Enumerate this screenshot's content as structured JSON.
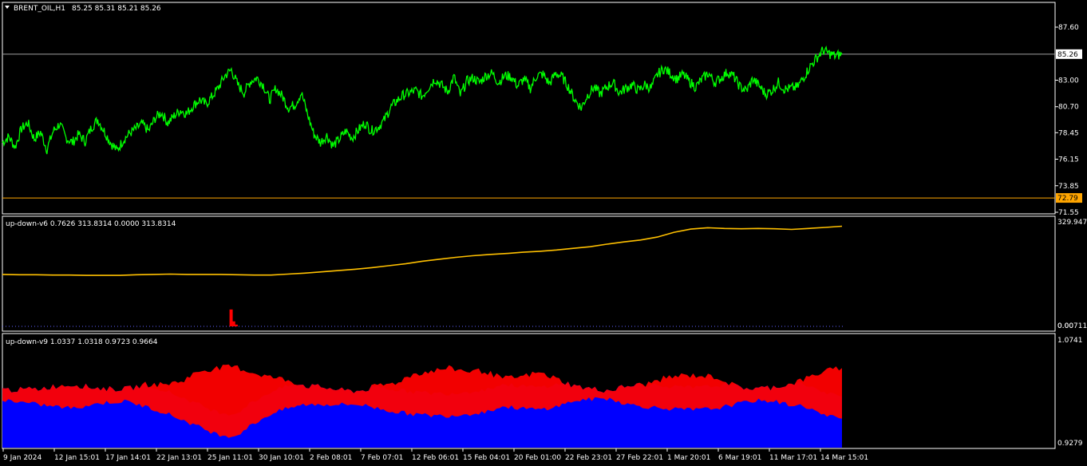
{
  "header": {
    "symbol": "BRENT_OIL,H1",
    "ohlc": "85.25 85.31 85.21 85.26"
  },
  "panels": {
    "price": {
      "y_ticks": [
        "87.60",
        "83.00",
        "80.70",
        "78.45",
        "76.15",
        "73.85",
        "71.55"
      ],
      "current_price_label": "85.26",
      "level_label": "72.79"
    },
    "ind1": {
      "title": "up-down-v6 0.7626 313.8314 0.0000 313.8314",
      "top_tick": "329.9472",
      "bottom_tick": "0.007118",
      "bottom_tick_overlay": "0.00"
    },
    "ind2": {
      "title": "up-down-v9 1.0337 1.0318 0.9723 0.9664",
      "top_tick": "1.0741",
      "bottom_tick": "0.9279"
    }
  },
  "x_axis": {
    "labels": [
      "9 Jan 2024",
      "12 Jan 15:01",
      "17 Jan 14:01",
      "22 Jan 13:01",
      "25 Jan 11:01",
      "30 Jan 10:01",
      "2 Feb 08:01",
      "7 Feb 07:01",
      "12 Feb 06:01",
      "15 Feb 04:01",
      "20 Feb 01:00",
      "22 Feb 23:01",
      "27 Feb 22:01",
      "1 Mar 20:01",
      "6 Mar 19:01",
      "11 Mar 17:01",
      "14 Mar 15:01"
    ]
  },
  "colors": {
    "background": "#000000",
    "price_line": "#00ff00",
    "level_line": "#ffa500",
    "current_line": "#a0a0a0",
    "ind1_line": "#ffc000",
    "ind1_bars": "#ff0000",
    "ind1_low": "#6060ff",
    "ind2_up": "#ff0000",
    "ind2_down": "#0000ff",
    "frame": "#ffffff"
  },
  "chart_data": [
    {
      "type": "line",
      "title": "BRENT_OIL,H1",
      "ylim": [
        71.55,
        87.6
      ],
      "series": [
        {
          "values": [
            77.6,
            78.1,
            77.2,
            78.8,
            79.3,
            77.9,
            78.5,
            77.0,
            78.6,
            79.2,
            78.0,
            77.6,
            78.3,
            77.7,
            78.9,
            79.6,
            78.6,
            77.6,
            76.9,
            77.8,
            78.4,
            78.8,
            79.2,
            78.6,
            79.7,
            80.2,
            79.3,
            79.9,
            80.4,
            80.1,
            80.8,
            81.3,
            80.9,
            81.6,
            82.4,
            83.4,
            83.9,
            82.6,
            81.9,
            82.9,
            83.2,
            82.6,
            81.3,
            82.3,
            81.6,
            80.6,
            80.9,
            81.9,
            80.0,
            78.3,
            77.6,
            78.2,
            77.3,
            77.9,
            78.6,
            78.0,
            78.7,
            79.3,
            78.6,
            78.9,
            79.5,
            80.6,
            81.2,
            81.7,
            81.9,
            82.1,
            81.6,
            82.4,
            83.1,
            82.6,
            82.0,
            83.3,
            81.7,
            82.9,
            83.2,
            82.8,
            83.4,
            83.6,
            82.8,
            83.4,
            83.3,
            82.5,
            83.1,
            82.3,
            83.4,
            83.5,
            82.7,
            83.6,
            83.3,
            82.4,
            81.3,
            80.6,
            81.7,
            82.4,
            81.8,
            82.4,
            82.8,
            81.9,
            82.3,
            82.6,
            82.1,
            82.6,
            82.3,
            83.5,
            84.0,
            83.6,
            83.1,
            83.5,
            82.9,
            82.4,
            83.1,
            83.6,
            82.8,
            83.2,
            83.7,
            83.3,
            82.4,
            82.1,
            83.1,
            82.5,
            81.8,
            82.1,
            82.8,
            82.2,
            82.3,
            82.4,
            83.3,
            84.2,
            84.9,
            85.6,
            85.3,
            85.1,
            85.26
          ]
        }
      ]
    },
    {
      "type": "line",
      "title": "up-down-v6 0.7626 313.8314 0.0000 313.8314",
      "ylim": [
        0.007118,
        329.9472
      ],
      "series": [
        {
          "values": [
            164,
            163,
            163,
            162,
            162,
            161,
            161,
            161,
            163,
            164,
            165,
            164,
            164,
            164,
            163,
            162,
            162,
            165,
            168,
            172,
            176,
            180,
            185,
            191,
            197,
            205,
            211,
            217,
            222,
            226,
            229,
            233,
            236,
            240,
            245,
            250,
            258,
            265,
            271,
            280,
            295,
            305,
            309,
            307,
            306,
            307,
            306,
            304,
            307,
            310,
            313.8
          ]
        }
      ],
      "bars": {
        "x_positions_pct": [
          27.0,
          27.3,
          27.6
        ],
        "values": [
          55,
          18,
          8
        ]
      }
    },
    {
      "type": "area",
      "title": "up-down-v9 1.0337 1.0318 0.9723 0.9664",
      "ylim": [
        0.9279,
        1.0741
      ],
      "series": [
        {
          "name": "",
          "values": [
            1.005,
            1.005,
            1.006,
            1.01,
            1.012,
            1.008,
            1.006,
            1.006,
            1.012,
            1.012,
            1.016,
            1.03,
            1.034,
            1.036,
            1.028,
            1.022,
            1.018,
            1.01,
            1.008,
            1.004,
            1.003,
            1.01,
            1.014,
            1.026,
            1.03,
            1.034,
            1.03,
            1.03,
            1.02,
            1.022,
            1.028,
            1.02,
            1.01,
            1.006,
            1.004,
            1.01,
            1.012,
            1.02,
            1.024,
            1.024,
            1.022,
            1.01,
            1.006,
            1.008,
            1.012,
            1.02,
            1.03,
            1.034
          ]
        },
        {
          "name": "",
          "values": [
            0.992,
            0.988,
            0.985,
            0.982,
            0.98,
            0.985,
            0.988,
            0.989,
            0.982,
            0.975,
            0.965,
            0.955,
            0.945,
            0.942,
            0.958,
            0.972,
            0.98,
            0.985,
            0.985,
            0.985,
            0.985,
            0.98,
            0.975,
            0.972,
            0.97,
            0.97,
            0.972,
            0.975,
            0.982,
            0.98,
            0.978,
            0.982,
            0.99,
            0.992,
            0.993,
            0.985,
            0.982,
            0.98,
            0.978,
            0.978,
            0.98,
            0.985,
            0.99,
            0.99,
            0.985,
            0.982,
            0.97,
            0.966
          ]
        }
      ]
    }
  ]
}
